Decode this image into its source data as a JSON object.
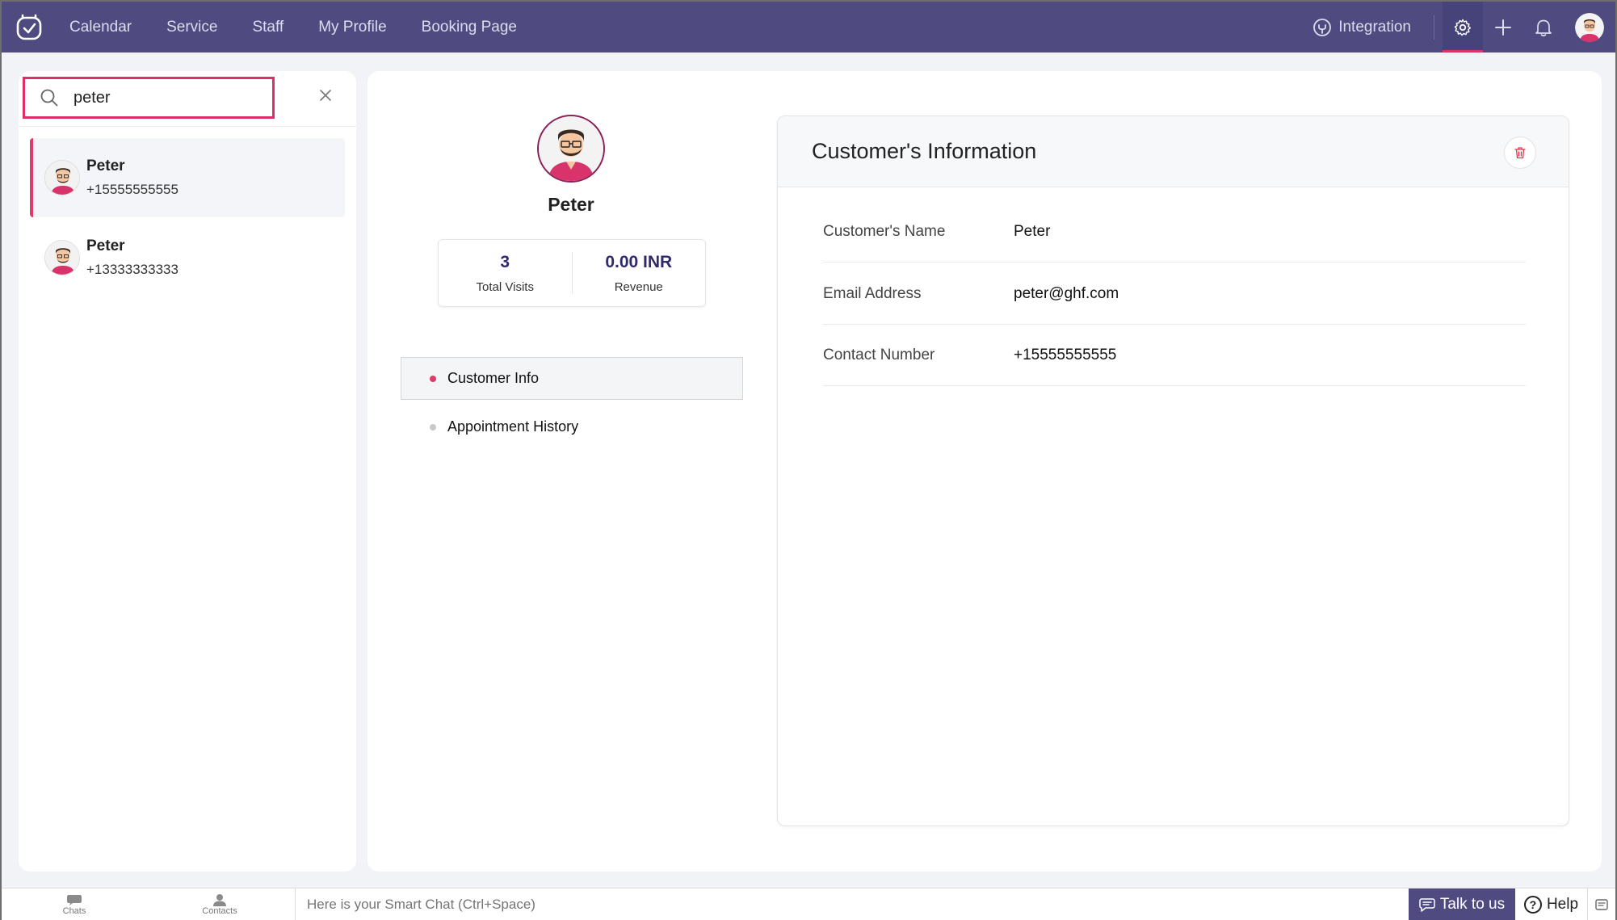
{
  "nav": {
    "items": [
      "Calendar",
      "Service",
      "Staff",
      "My Profile",
      "Booking Page"
    ],
    "integration_label": "Integration",
    "icons": [
      "settings-icon",
      "plus-icon",
      "bell-icon"
    ]
  },
  "search": {
    "value": "peter"
  },
  "customers": [
    {
      "name": "Peter",
      "phone": "+15555555555",
      "selected": true
    },
    {
      "name": "Peter",
      "phone": "+13333333333",
      "selected": false
    }
  ],
  "profile": {
    "name": "Peter",
    "total_visits_value": "3",
    "total_visits_label": "Total Visits",
    "revenue_value": "0.00 INR",
    "revenue_label": "Revenue"
  },
  "tabs": [
    {
      "label": "Customer Info",
      "active": true
    },
    {
      "label": "Appointment History",
      "active": false
    }
  ],
  "info": {
    "title": "Customer's Information",
    "rows": [
      {
        "label": "Customer's Name",
        "value": "Peter"
      },
      {
        "label": "Email Address",
        "value": "peter@ghf.com"
      },
      {
        "label": "Contact Number",
        "value": "+15555555555"
      }
    ]
  },
  "bottom": {
    "chats_label": "Chats",
    "contacts_label": "Contacts",
    "smart_chat_placeholder": "Here is your Smart Chat (Ctrl+Space)",
    "talk_label": "Talk to us",
    "help_label": "Help"
  },
  "colors": {
    "topbar": "#4f4b80",
    "accent": "#e03a6a",
    "stat_value": "#2f2a6b"
  }
}
